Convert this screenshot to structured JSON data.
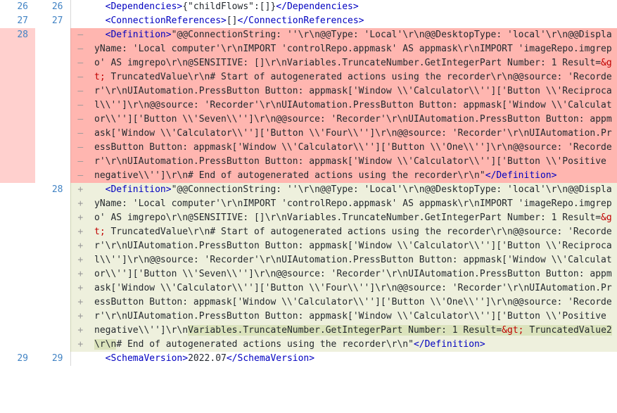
{
  "view": {
    "kind": "unified-diff",
    "theme": "github-light",
    "colors": {
      "deletion_bg": "#ffb6b0",
      "deletion_gutter_bg": "#ffd0ce",
      "addition_bg": "#eef0dd",
      "addition_word_highlight_bg": "#dbe3bc",
      "line_number_color": "#4183c4",
      "tag_bracket_color": "#0000c0",
      "tag_name_color": "#c00000",
      "entity_color": "#c00000",
      "text_color": "#24292e",
      "page_bg": "#ffffff"
    },
    "markers": {
      "deletion": "—",
      "addition": "+",
      "context": ""
    }
  },
  "rows": [
    {
      "type": "context",
      "old_line": "26",
      "new_line": "26",
      "marker": "",
      "segments": [
        {
          "text": "  ",
          "style": "plain"
        },
        {
          "text": "<Dependencies>",
          "style": "tag"
        },
        {
          "text": "{\"childFlows\":[]}",
          "style": "plain"
        },
        {
          "text": "</Dependencies>",
          "style": "tag"
        }
      ]
    },
    {
      "type": "context",
      "old_line": "27",
      "new_line": "27",
      "marker": "",
      "segments": [
        {
          "text": "  ",
          "style": "plain"
        },
        {
          "text": "<ConnectionReferences>",
          "style": "tag"
        },
        {
          "text": "[]",
          "style": "plain"
        },
        {
          "text": "</ConnectionReferences>",
          "style": "tag"
        }
      ]
    },
    {
      "type": "deletion",
      "old_line": "28",
      "new_line": "",
      "marker": "—",
      "segments": [
        {
          "text": "  ",
          "style": "plain"
        },
        {
          "text": "<Definition>",
          "style": "tag"
        },
        {
          "text": "\"@@ConnectionString: ''\\r\\n@@Type: 'Local'\\r\\n@@DesktopType: 'local'\\r\\n@@DisplayName: 'Local computer'\\r\\nIMPORT 'controlRepo.appmask' AS appmask\\r\\nIMPORT 'imageRepo.imgrepo' AS imgrepo\\r\\n@SENSITIVE: []\\r\\nVariables.TruncateNumber.GetIntegerPart Number: 1 Result=",
          "style": "plain"
        },
        {
          "text": "&gt;",
          "style": "ent"
        },
        {
          "text": " TruncatedValue\\r\\n# Start of autogenerated actions using the recorder\\r\\n@@source: 'Recorder'\\r\\nUIAutomation.PressButton Button: appmask['Window \\\\'Calculator\\\\'']['Button \\\\'Reciprocal\\\\'']\\r\\n@@source: 'Recorder'\\r\\nUIAutomation.PressButton Button: appmask['Window \\\\'Calculator\\\\'']['Button \\\\'Seven\\\\'']\\r\\n@@source: 'Recorder'\\r\\nUIAutomation.PressButton Button: appmask['Window \\\\'Calculator\\\\'']['Button \\\\'Four\\\\'']\\r\\n@@source: 'Recorder'\\r\\nUIAutomation.PressButton Button: appmask['Window \\\\'Calculator\\\\'']['Button \\\\'One\\\\'']\\r\\n@@source: 'Recorder'\\r\\nUIAutomation.PressButton Button: appmask['Window \\\\'Calculator\\\\'']['Button \\\\'Positive negative\\\\'']\\r\\n# End of autogenerated actions using the recorder\\r\\n\"",
          "style": "plain"
        },
        {
          "text": "</Definition>",
          "style": "tag"
        }
      ]
    },
    {
      "type": "addition",
      "old_line": "",
      "new_line": "28",
      "marker": "+",
      "segments": [
        {
          "text": "  ",
          "style": "plain"
        },
        {
          "text": "<Definition>",
          "style": "tag"
        },
        {
          "text": "\"@@ConnectionString: ''\\r\\n@@Type: 'Local'\\r\\n@@DesktopType: 'local'\\r\\n@@DisplayName: 'Local computer'\\r\\nIMPORT 'controlRepo.appmask' AS appmask\\r\\nIMPORT 'imageRepo.imgrepo' AS imgrepo\\r\\n@SENSITIVE: []\\r\\nVariables.TruncateNumber.GetIntegerPart Number: 1 Result=",
          "style": "plain"
        },
        {
          "text": "&gt;",
          "style": "ent"
        },
        {
          "text": " TruncatedValue\\r\\n# Start of autogenerated actions using the recorder\\r\\n@@source: 'Recorder'\\r\\nUIAutomation.PressButton Button: appmask['Window \\\\'Calculator\\\\'']['Button \\\\'Reciprocal\\\\'']\\r\\n@@source: 'Recorder'\\r\\nUIAutomation.PressButton Button: appmask['Window \\\\'Calculator\\\\'']['Button \\\\'Seven\\\\'']\\r\\n@@source: 'Recorder'\\r\\nUIAutomation.PressButton Button: appmask['Window \\\\'Calculator\\\\'']['Button \\\\'Four\\\\'']\\r\\n@@source: 'Recorder'\\r\\nUIAutomation.PressButton Button: appmask['Window \\\\'Calculator\\\\'']['Button \\\\'One\\\\'']\\r\\n@@source: 'Recorder'\\r\\nUIAutomation.PressButton Button: appmask['Window \\\\'Calculator\\\\'']['Button \\\\'Positive negative\\\\'']\\r\\n",
          "style": "plain"
        },
        {
          "text": "Variables.TruncateNumber.GetIntegerPart Number: 1 Result=",
          "style": "plain-hl"
        },
        {
          "text": "&gt;",
          "style": "ent-hl"
        },
        {
          "text": " TruncatedValue2\\r\\n",
          "style": "plain-hl"
        },
        {
          "text": "# End of autogenerated actions using the recorder\\r\\n\"",
          "style": "plain"
        },
        {
          "text": "</Definition>",
          "style": "tag"
        }
      ]
    },
    {
      "type": "context",
      "old_line": "29",
      "new_line": "29",
      "marker": "",
      "segments": [
        {
          "text": "  ",
          "style": "plain"
        },
        {
          "text": "<SchemaVersion>",
          "style": "tag"
        },
        {
          "text": "2022.07",
          "style": "plain"
        },
        {
          "text": "</SchemaVersion>",
          "style": "tag"
        }
      ]
    }
  ]
}
